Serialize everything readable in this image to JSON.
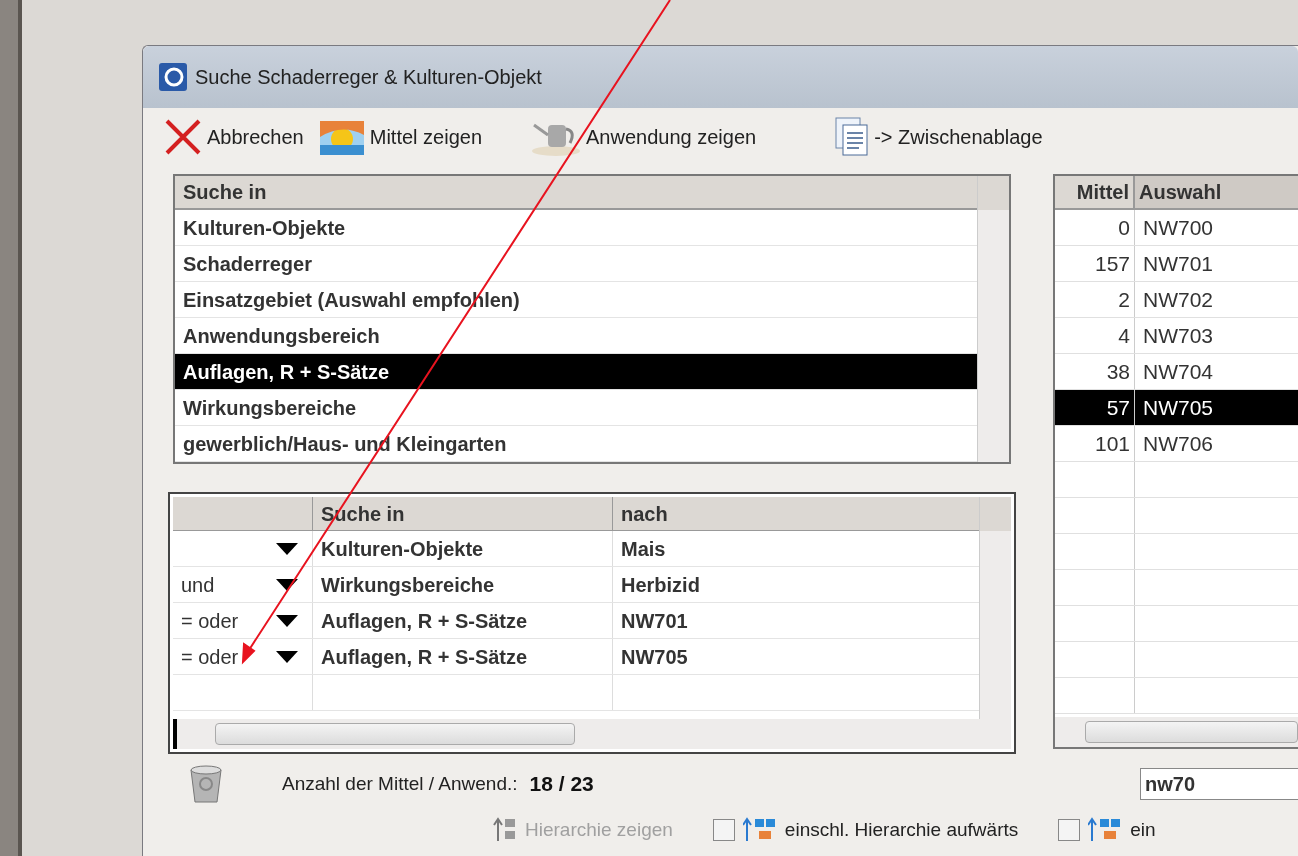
{
  "window": {
    "title": "Suche Schaderreger & Kulturen-Objekt"
  },
  "toolbar": [
    {
      "kind": "cancel",
      "label": "Abbrechen"
    },
    {
      "kind": "sun",
      "label": "Mittel zeigen"
    },
    {
      "kind": "sprayer",
      "label": "Anwendung zeigen"
    },
    {
      "kind": "document",
      "label": "-> Zwischenablage"
    }
  ],
  "search_in_list": {
    "header": "Suche in",
    "items": [
      {
        "label": "Kulturen-Objekte",
        "selected": false
      },
      {
        "label": "Schaderreger",
        "selected": false
      },
      {
        "label": "Einsatzgebiet (Auswahl empfohlen)",
        "selected": false
      },
      {
        "label": "Anwendungsbereich",
        "selected": false
      },
      {
        "label": "Auflagen, R + S-Sätze",
        "selected": true
      },
      {
        "label": "Wirkungsbereiche",
        "selected": false
      },
      {
        "label": "gewerblich/Haus- und Kleingarten",
        "selected": false
      }
    ]
  },
  "criteria_table": {
    "columns": [
      "Suche in",
      "nach"
    ],
    "rows": [
      {
        "field": "Kulturen-Objekte",
        "value": "Mais"
      },
      {
        "operator": "und",
        "field": "Wirkungsbereiche",
        "value": "Herbizid"
      },
      {
        "operator": "= oder",
        "field": "Auflagen, R + S-Sätze",
        "value": "NW701"
      },
      {
        "operator": "= oder",
        "field": "Auflagen, R + S-Sätze",
        "value": "NW705"
      }
    ]
  },
  "results_table": {
    "columns": [
      "Mittel",
      "Auswahl"
    ],
    "rows": [
      {
        "count": "0",
        "code": "NW700",
        "selected": false
      },
      {
        "count": "157",
        "code": "NW701",
        "selected": false
      },
      {
        "count": "2",
        "code": "NW702",
        "selected": false
      },
      {
        "count": "4",
        "code": "NW703",
        "selected": false
      },
      {
        "count": "38",
        "code": "NW704",
        "selected": false
      },
      {
        "count": "57",
        "code": "NW705",
        "selected": true
      },
      {
        "count": "101",
        "code": "NW706",
        "selected": false
      }
    ]
  },
  "footer": {
    "count_label": "Anzahl der Mittel / Anwend.:",
    "count_value": "18 / 23",
    "search_value": "nw70"
  },
  "options": [
    {
      "kind": "button",
      "label": "Hierarchie zeigen",
      "disabled": true
    },
    {
      "kind": "checkbox",
      "label": "einschl. Hierarchie aufwärts",
      "checked": false
    },
    {
      "kind": "checkbox",
      "label": "ein",
      "checked": false
    }
  ]
}
